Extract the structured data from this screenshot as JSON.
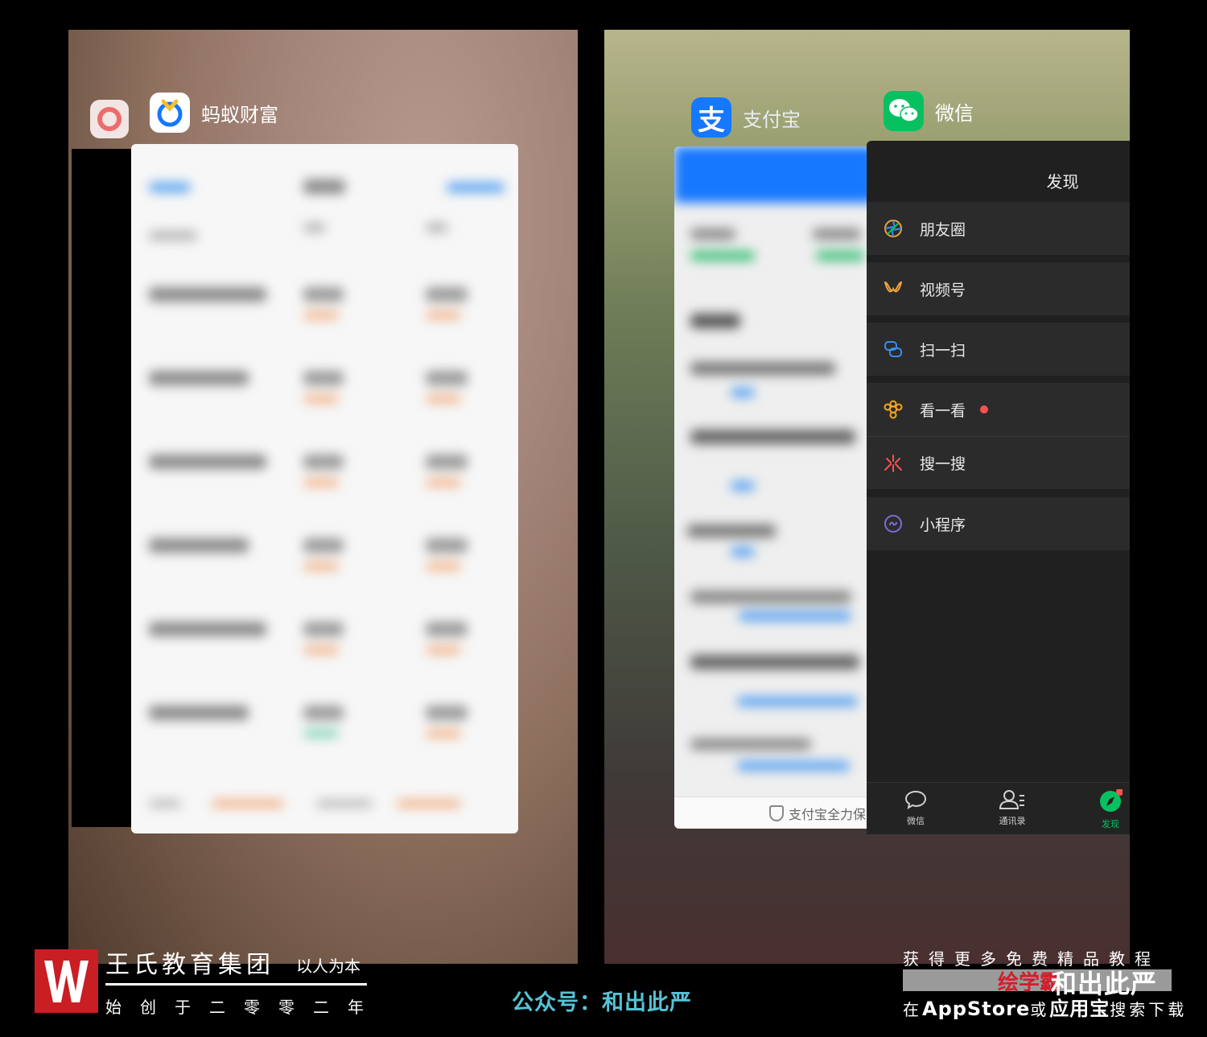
{
  "left_app": {
    "name": "蚂蚁财富"
  },
  "right_apps": {
    "alipay_name": "支付宝",
    "wechat_name": "微信"
  },
  "alipay": {
    "footer": "支付宝全力保"
  },
  "wechat": {
    "title": "发现",
    "items": [
      {
        "label": "朋友圈",
        "icon": "moments-icon",
        "color": "#f2a33a"
      },
      {
        "label": "视频号",
        "icon": "channels-icon",
        "color": "#f0a23c"
      },
      {
        "label": "扫一扫",
        "icon": "scan-icon",
        "color": "#3a8ef0"
      },
      {
        "label": "看一看",
        "icon": "top-stories-icon",
        "color": "#f5a623"
      },
      {
        "label": "搜一搜",
        "icon": "search-icon",
        "color": "#fa5151"
      },
      {
        "label": "小程序",
        "icon": "mini-program-icon",
        "color": "#7b6cd9"
      }
    ],
    "tabs": [
      {
        "label": "微信",
        "icon": "chat-icon"
      },
      {
        "label": "通讯录",
        "icon": "contacts-icon"
      },
      {
        "label": "发现",
        "icon": "discover-icon",
        "active_color": "#07c160"
      }
    ]
  },
  "branding": {
    "logo_letter": "W",
    "title": "王氏教育集团",
    "slogan": "以人为本",
    "founded": "始创于二零零二年",
    "gongzhonghao": "公众号：和出此严",
    "promo_top": "获得更多免费精品教程",
    "promo_red": "绘学霸",
    "promo_brand": "和出此严",
    "promo_bottom_prefix": "在",
    "promo_appstore": "AppStore",
    "promo_or": "或",
    "promo_yyb": "应用宝",
    "promo_suffix": "搜索下载"
  },
  "colors": {
    "logo_red": "#c81e24",
    "gongzhonghao": "#55c3d6",
    "alipay_blue": "#1677ff",
    "wechat_green": "#07c160"
  }
}
